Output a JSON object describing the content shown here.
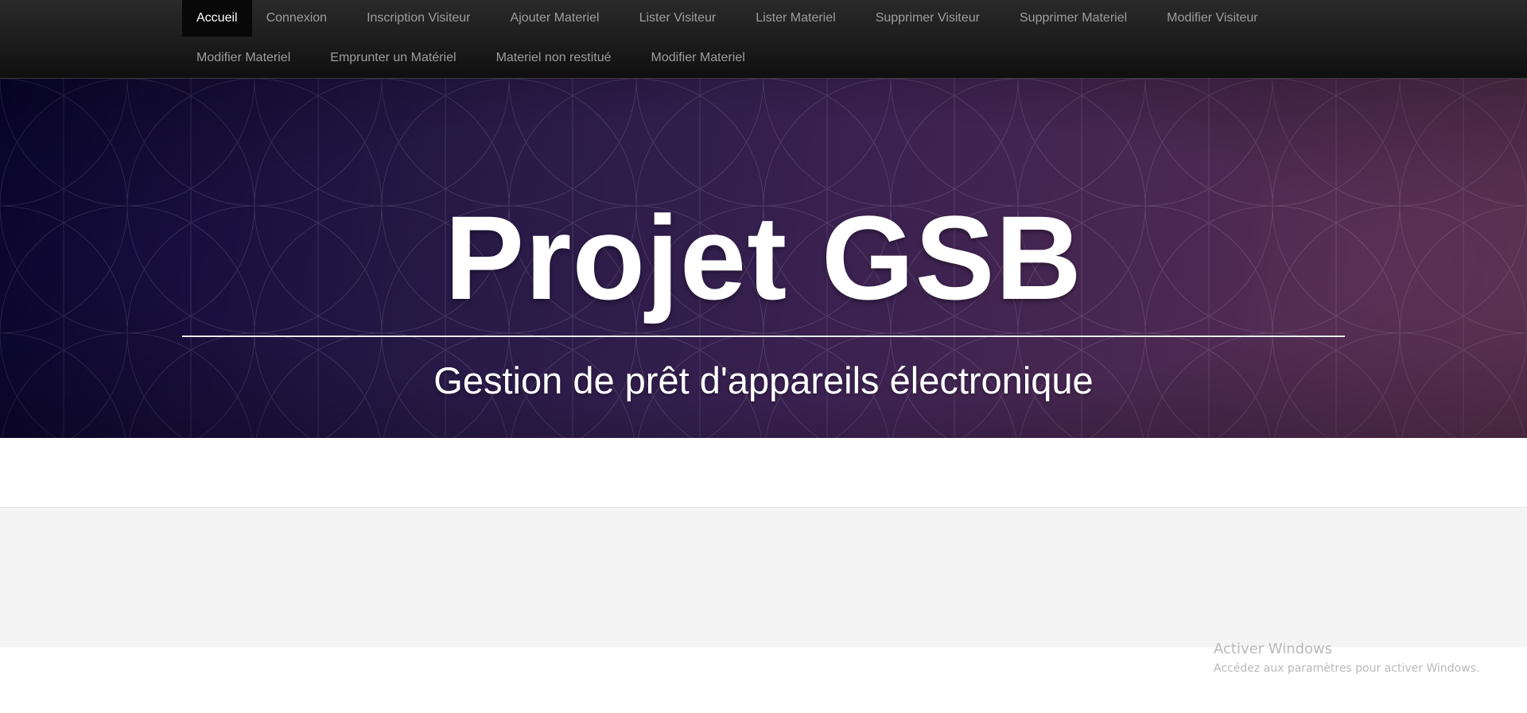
{
  "nav": {
    "row1": [
      {
        "label": "Accueil",
        "active": true
      },
      {
        "label": "Connexion"
      },
      {
        "label": "Inscription Visiteur"
      },
      {
        "label": "Ajouter Materiel"
      },
      {
        "label": "Lister Visiteur"
      },
      {
        "label": "Lister Materiel"
      },
      {
        "label": "Supprimer Visiteur"
      },
      {
        "label": "Supprimer Materiel"
      },
      {
        "label": "Modifier Visiteur"
      }
    ],
    "row2": [
      {
        "label": "Modifier Materiel"
      },
      {
        "label": "Emprunter un Matériel"
      },
      {
        "label": "Materiel non restitué"
      },
      {
        "label": "Modifier Materiel"
      }
    ]
  },
  "hero": {
    "title": "Projet GSB",
    "subtitle": "Gestion de prêt d'appareils électronique"
  },
  "windows_watermark": {
    "title": "Activer Windows",
    "subtitle": "Accédez aux paramètres pour activer Windows."
  },
  "colors": {
    "navbar": "#1c1c1c",
    "nav_text": "#9d9d9d",
    "nav_active_bg": "#080808",
    "hero_start": "#0c0636",
    "hero_end": "#6a3a5e",
    "footer_bg": "#f4f4f4"
  }
}
